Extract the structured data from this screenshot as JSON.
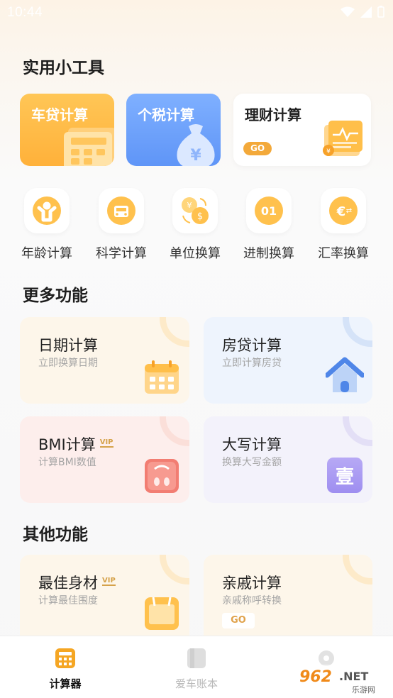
{
  "status": {
    "time": "10:44"
  },
  "tools_section": {
    "title": "实用小工具",
    "car_loan": "车贷计算",
    "tax": "个税计算",
    "finance": "理财计算",
    "finance_go": "GO"
  },
  "round_tools": [
    {
      "label": "年龄计算",
      "icon": "person-icon"
    },
    {
      "label": "科学计算",
      "icon": "car-icon"
    },
    {
      "label": "单位换算",
      "icon": "currency-exchange-icon"
    },
    {
      "label": "进制换算",
      "icon": "binary-icon"
    },
    {
      "label": "汇率换算",
      "icon": "euro-exchange-icon"
    }
  ],
  "more_section": {
    "title": "更多功能",
    "cards": [
      {
        "title": "日期计算",
        "subtitle": "立即换算日期"
      },
      {
        "title": "房贷计算",
        "subtitle": "立即计算房贷"
      },
      {
        "title": "BMI计算",
        "subtitle": "计算BMI数值",
        "badge": "VIP"
      },
      {
        "title": "大写计算",
        "subtitle": "换算大写金额",
        "icon_text": "壹"
      }
    ]
  },
  "other_section": {
    "title": "其他功能",
    "cards": [
      {
        "title": "最佳身材",
        "subtitle": "计算最佳围度",
        "badge": "VIP"
      },
      {
        "title": "亲戚计算",
        "subtitle": "亲戚称呼转换",
        "go": "GO"
      }
    ]
  },
  "bottom_nav": [
    {
      "label": "计算器",
      "active": true
    },
    {
      "label": "爱车账本",
      "active": false
    },
    {
      "label": "",
      "active": false
    }
  ],
  "watermark": {
    "text": "962.NET",
    "sub": "乐游网"
  },
  "colors": {
    "accent": "#f5a623",
    "blue": "#5f95f7",
    "active_nav": "#111111",
    "inactive_nav": "#b8b8b8"
  }
}
